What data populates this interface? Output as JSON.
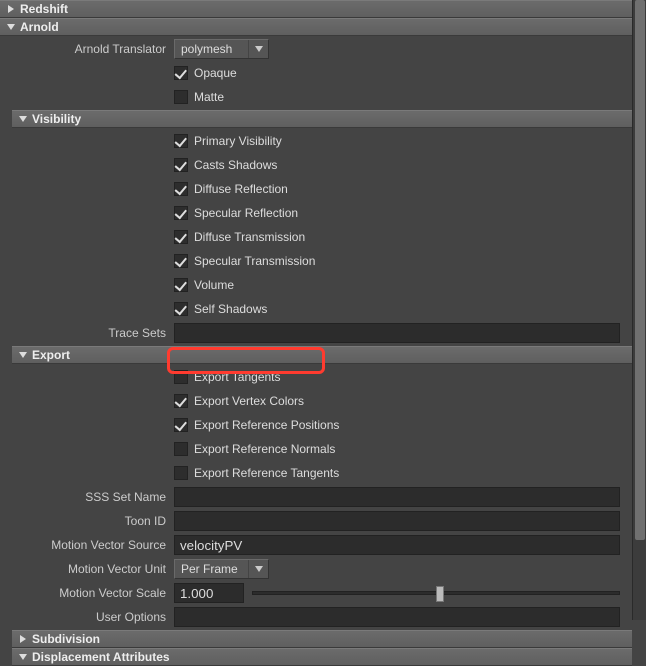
{
  "sections": {
    "redshift": {
      "title": "Redshift",
      "expanded": false
    },
    "arnold": {
      "title": "Arnold",
      "expanded": true
    },
    "visibility": {
      "title": "Visibility",
      "expanded": true
    },
    "export": {
      "title": "Export",
      "expanded": true
    },
    "subdivision": {
      "title": "Subdivision",
      "expanded": false
    },
    "displacement": {
      "title": "Displacement Attributes",
      "expanded": false
    }
  },
  "arnold": {
    "translator_label": "Arnold Translator",
    "translator_value": "polymesh",
    "opaque_label": "Opaque",
    "opaque_checked": true,
    "matte_label": "Matte",
    "matte_checked": false
  },
  "visibility": {
    "items": [
      {
        "label": "Primary Visibility",
        "checked": true
      },
      {
        "label": "Casts Shadows",
        "checked": true
      },
      {
        "label": "Diffuse Reflection",
        "checked": true
      },
      {
        "label": "Specular Reflection",
        "checked": true
      },
      {
        "label": "Diffuse Transmission",
        "checked": true
      },
      {
        "label": "Specular Transmission",
        "checked": true
      },
      {
        "label": "Volume",
        "checked": true
      },
      {
        "label": "Self Shadows",
        "checked": true
      }
    ],
    "trace_sets_label": "Trace Sets",
    "trace_sets_value": ""
  },
  "export": {
    "items": [
      {
        "label": "Export Tangents",
        "checked": false
      },
      {
        "label": "Export Vertex Colors",
        "checked": true
      },
      {
        "label": "Export Reference Positions",
        "checked": true
      },
      {
        "label": "Export Reference Normals",
        "checked": false
      },
      {
        "label": "Export Reference Tangents",
        "checked": false
      }
    ],
    "sss_set_label": "SSS Set Name",
    "sss_set_value": "",
    "toon_id_label": "Toon ID",
    "toon_id_value": "",
    "mv_source_label": "Motion Vector Source",
    "mv_source_value": "velocityPV",
    "mv_unit_label": "Motion Vector Unit",
    "mv_unit_value": "Per Frame",
    "mv_scale_label": "Motion Vector Scale",
    "mv_scale_value": "1.000",
    "mv_scale_pos": 0.5,
    "user_options_label": "User Options",
    "user_options_value": ""
  }
}
